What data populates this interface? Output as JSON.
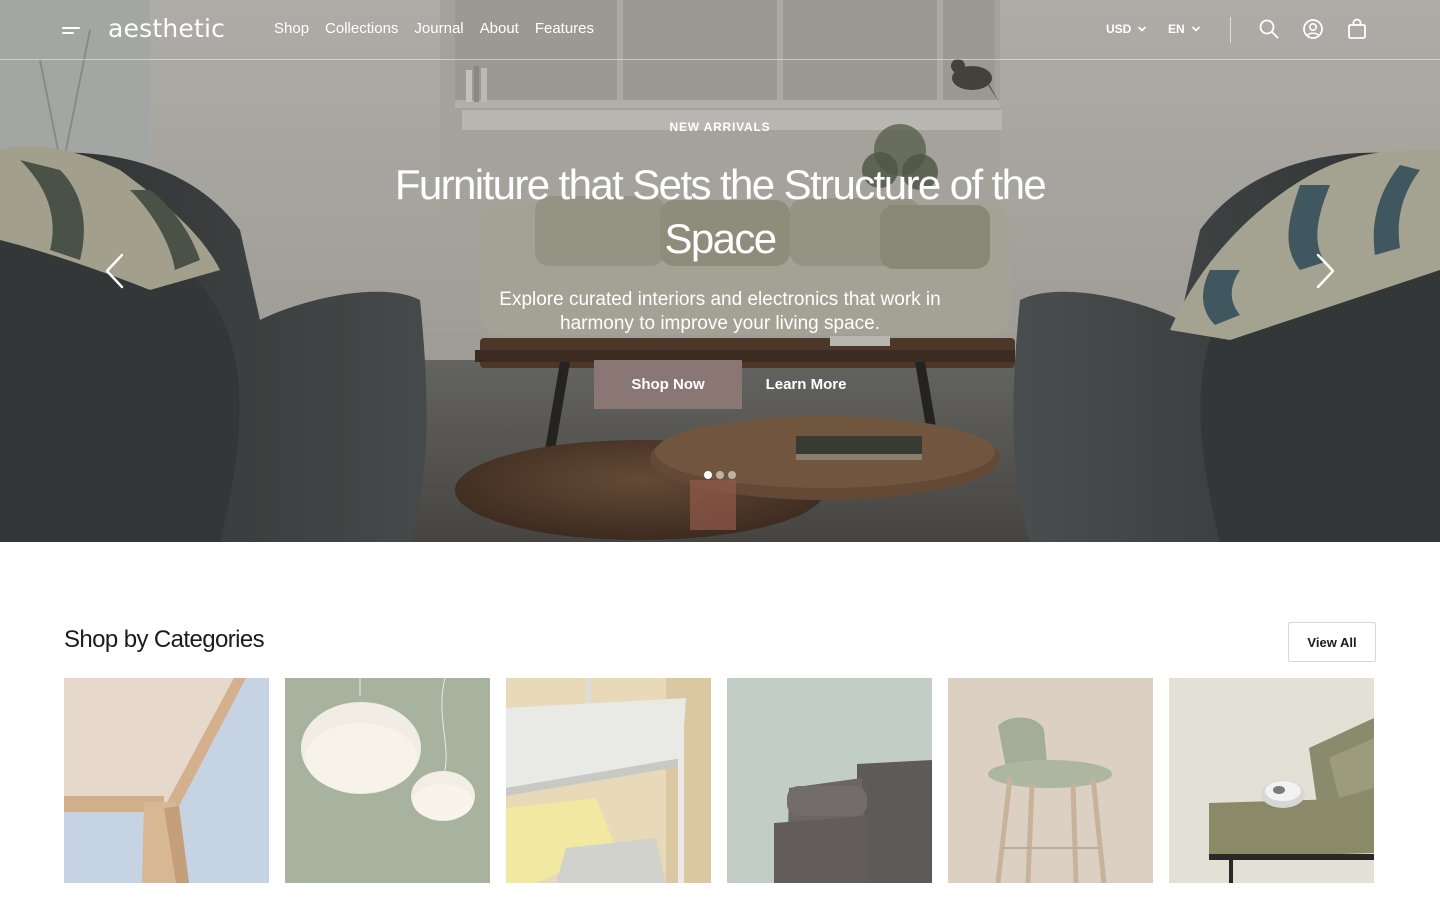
{
  "header": {
    "logo": "aesthetic",
    "nav": [
      "Shop",
      "Collections",
      "Journal",
      "About",
      "Features"
    ],
    "currency": "USD",
    "language": "EN",
    "icons": [
      "menu-icon",
      "search-icon",
      "account-icon",
      "bag-icon",
      "chevron-down-icon"
    ]
  },
  "hero": {
    "eyebrow": "NEW ARRIVALS",
    "title": "Furniture that Sets the Structure of the Space",
    "subtitle": "Explore curated interiors and electronics that work in harmony to improve your living space.",
    "primary_cta": "Shop Now",
    "secondary_cta": "Learn More",
    "slide_count": 3,
    "active_slide": 1,
    "icons": [
      "chevron-left-icon",
      "chevron-right-icon"
    ]
  },
  "categories": {
    "title": "Shop by Categories",
    "view_all": "View All",
    "item_count": 6
  },
  "colors": {
    "primary_button": "#8a7672",
    "text": "#1c1c1c",
    "header_text": "#ffffff"
  }
}
